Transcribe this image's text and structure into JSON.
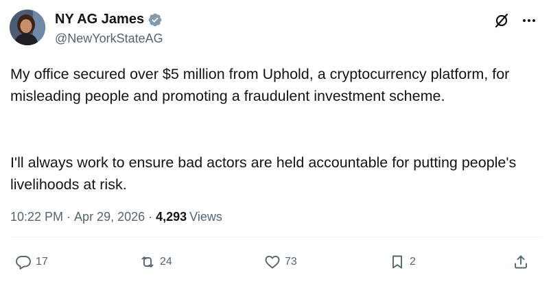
{
  "author": {
    "display_name": "NY AG James",
    "handle": "@NewYorkStateAG"
  },
  "tweet": {
    "paragraph_1": "My office secured over $5 million from Uphold, a cryptocurrency platform, for misleading people and promoting a fraudulent investment scheme.",
    "paragraph_2": "I'll always work to ensure bad actors are held accountable for putting people's livelihoods at risk."
  },
  "meta": {
    "time": "10:22 PM",
    "separator": "·",
    "date": "Apr 29, 2026",
    "views_count": "4,293",
    "views_label": "Views"
  },
  "actions": {
    "replies": "17",
    "reposts": "24",
    "likes": "73",
    "bookmarks": "2"
  },
  "icons": {
    "verified": "verified-badge-icon",
    "grok": "grok-icon",
    "more": "more-icon",
    "reply": "reply-icon",
    "repost": "repost-icon",
    "like": "heart-icon",
    "bookmark": "bookmark-icon",
    "share": "share-icon"
  },
  "colors": {
    "text_primary": "#0f1419",
    "text_secondary": "#536471",
    "verified_badge": "#829aab"
  }
}
